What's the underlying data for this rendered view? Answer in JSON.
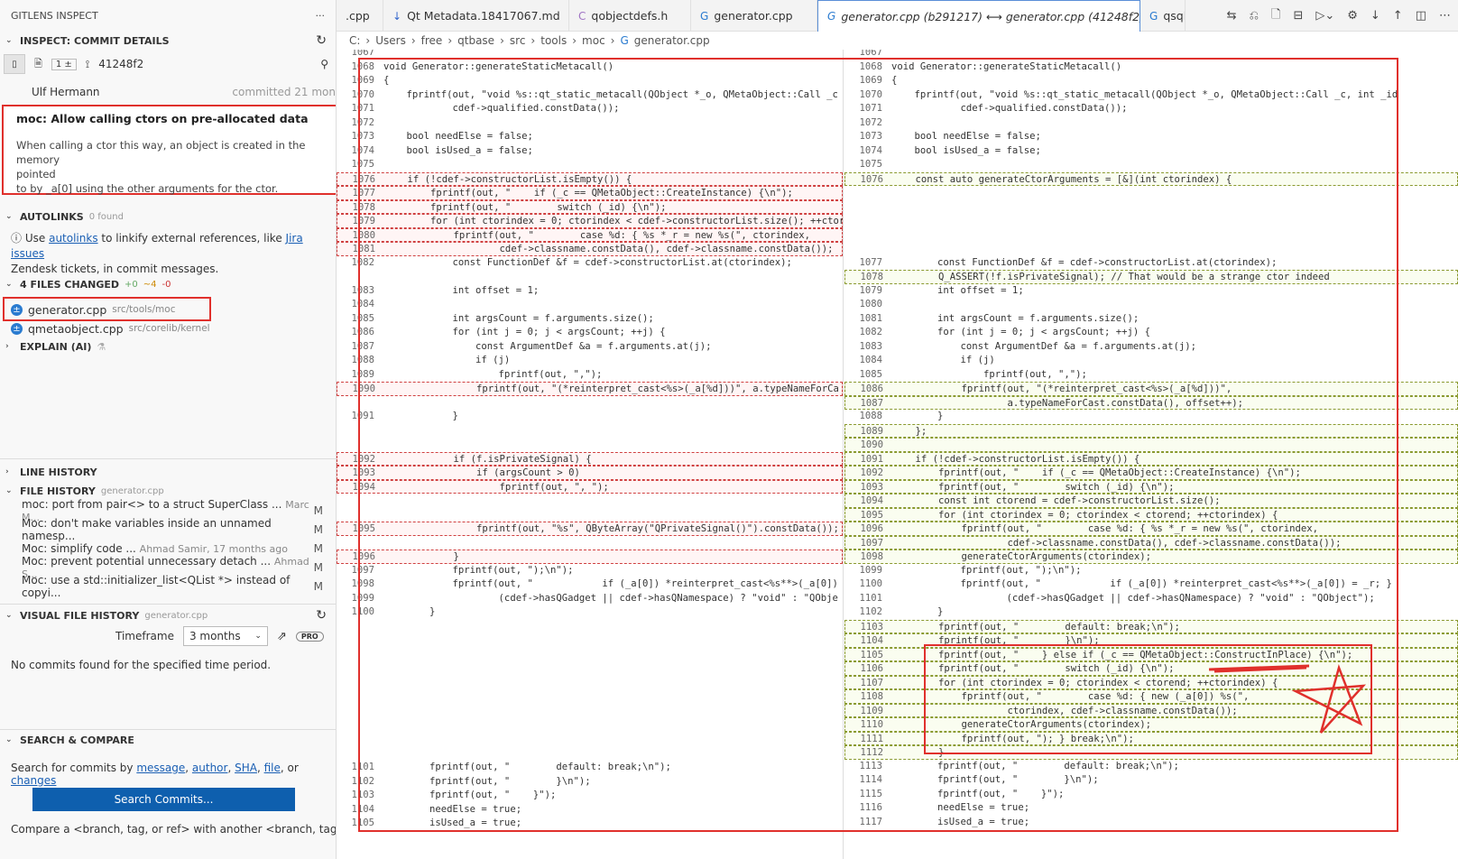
{
  "sidebar": {
    "header": "GITLENS INSPECT",
    "more": "···",
    "inspect": {
      "title": "INSPECT: COMMIT DETAILS",
      "change_count": "1 ±",
      "sha": "41248f2",
      "author": "Ulf Hermann",
      "committed": "committed 21 mon",
      "message_title": "moc: Allow calling ctors on pre-allocated data",
      "message_l1": "When calling a ctor this way, an object is created in the memory",
      "message_l2": "pointed",
      "message_l3": "to by _a[0] using the other arguments for the ctor."
    },
    "autolinks": {
      "title": "AUTOLINKS",
      "count": "0 found",
      "text1": "Use",
      "link1": "autolinks",
      "text2": "to linkify external references, like",
      "link2": "Jira issues",
      "text3": "Zendesk tickets, in commit messages."
    },
    "files": {
      "title": "4 FILES CHANGED",
      "stats_plus": "+0",
      "stats_tilde": "~4",
      "stats_minus": "-0",
      "items": [
        {
          "name": "generator.cpp",
          "path": "src/tools/moc"
        },
        {
          "name": "qmetaobject.cpp",
          "path": "src/corelib/kernel"
        }
      ]
    },
    "explain": {
      "title": "EXPLAIN (AI)"
    },
    "line_history": {
      "title": "LINE HISTORY"
    },
    "file_history": {
      "title": "FILE HISTORY",
      "file": "generator.cpp",
      "items": [
        {
          "msg": "moc: port from pair<> to a struct SuperClass ...",
          "author": "Marc M...",
          "status": "M"
        },
        {
          "msg": "Moc: don't make variables inside an unnamed namesp...",
          "author": "",
          "status": "M"
        },
        {
          "msg": "Moc: simplify code ...",
          "author": "Ahmad Samir, 17 months ago",
          "status": "M"
        },
        {
          "msg": "Moc: prevent potential unnecessary detach ...",
          "author": "Ahmad S...",
          "status": "M"
        },
        {
          "msg": "Moc: use a std::initializer_list<QList *> instead of copyi...",
          "author": "",
          "status": "M"
        }
      ]
    },
    "visual_history": {
      "title": "VISUAL FILE HISTORY",
      "file": "generator.cpp",
      "timeframe_label": "Timeframe",
      "timeframe_value": "3 months",
      "pro": "PRO",
      "empty": "No commits found for the specified time period."
    },
    "search": {
      "title": "SEARCH & COMPARE",
      "text": "Search for commits by",
      "l1": "message",
      "l2": "author",
      "l3": "SHA",
      "l4": "file",
      "or": "or",
      "l5": "changes",
      "button": "Search Commits...",
      "compare": "Compare a <branch, tag, or ref> with another <branch, tag"
    }
  },
  "tabs": [
    {
      "label": ".cpp",
      "icon": ""
    },
    {
      "label": "Qt Metadata.18417067.md",
      "icon": "↓"
    },
    {
      "label": "qobjectdefs.h",
      "icon": "C"
    },
    {
      "label": "generator.cpp",
      "icon": "G"
    },
    {
      "label": "generator.cpp (b291217) ⟷ generator.cpp (41248f2)",
      "icon": "G"
    },
    {
      "label": "qsql",
      "icon": "G"
    }
  ],
  "breadcrumb": [
    "C:",
    "Users",
    "free",
    "qtbase",
    "src",
    "tools",
    "moc",
    "generator.cpp"
  ],
  "left_lines": [
    {
      "n": "1067",
      "t": ""
    },
    {
      "n": "1068",
      "t": "void Generator::generateStaticMetacall()"
    },
    {
      "n": "1069",
      "t": "{"
    },
    {
      "n": "1070",
      "t": "    fprintf(out, \"void %s::qt_static_metacall(QObject *_o, QMetaObject::Call _c"
    },
    {
      "n": "1071",
      "t": "            cdef->qualified.constData());"
    },
    {
      "n": "1072",
      "t": ""
    },
    {
      "n": "1073",
      "t": "    bool needElse = false;"
    },
    {
      "n": "1074",
      "t": "    bool isUsed_a = false;"
    },
    {
      "n": "1075",
      "t": ""
    },
    {
      "n": "1076",
      "t": "    if (!cdef->constructorList.isEmpty()) {",
      "c": "del"
    },
    {
      "n": "1077",
      "t": "        fprintf(out, \"    if (_c == QMetaObject::CreateInstance) {\\n\");",
      "c": "del"
    },
    {
      "n": "1078",
      "t": "        fprintf(out, \"        switch (_id) {\\n\");",
      "c": "del"
    },
    {
      "n": "1079",
      "t": "        for (int ctorindex = 0; ctorindex < cdef->constructorList.size(); ++ctor",
      "c": "del"
    },
    {
      "n": "1080",
      "t": "            fprintf(out, \"        case %d: { %s *_r = new %s(\", ctorindex,",
      "c": "del"
    },
    {
      "n": "1081",
      "t": "                    cdef->classname.constData(), cdef->classname.constData());",
      "c": "del"
    },
    {
      "n": "1082",
      "t": "            const FunctionDef &f = cdef->constructorList.at(ctorindex);"
    },
    {
      "n": "",
      "t": ""
    },
    {
      "n": "1083",
      "t": "            int offset = 1;"
    },
    {
      "n": "1084",
      "t": ""
    },
    {
      "n": "1085",
      "t": "            int argsCount = f.arguments.size();"
    },
    {
      "n": "1086",
      "t": "            for (int j = 0; j < argsCount; ++j) {"
    },
    {
      "n": "1087",
      "t": "                const ArgumentDef &a = f.arguments.at(j);"
    },
    {
      "n": "1088",
      "t": "                if (j)"
    },
    {
      "n": "1089",
      "t": "                    fprintf(out, \",\");"
    },
    {
      "n": "1090",
      "t": "                fprintf(out, \"(*reinterpret_cast<%s>(_a[%d]))\", a.typeNameForCa",
      "c": "del"
    },
    {
      "n": "",
      "t": ""
    },
    {
      "n": "1091",
      "t": "            }"
    },
    {
      "n": "",
      "t": ""
    },
    {
      "n": "",
      "t": ""
    },
    {
      "n": "1092",
      "t": "            if (f.isPrivateSignal) {",
      "c": "del"
    },
    {
      "n": "1093",
      "t": "                if (argsCount > 0)",
      "c": "del"
    },
    {
      "n": "1094",
      "t": "                    fprintf(out, \", \");",
      "c": "del"
    },
    {
      "n": "",
      "t": ""
    },
    {
      "n": "",
      "t": ""
    },
    {
      "n": "1095",
      "t": "                fprintf(out, \"%s\", QByteArray(\"QPrivateSignal()\").constData());",
      "c": "del"
    },
    {
      "n": "",
      "t": ""
    },
    {
      "n": "1096",
      "t": "            }",
      "c": "del"
    },
    {
      "n": "1097",
      "t": "            fprintf(out, \");\\n\");"
    },
    {
      "n": "1098",
      "t": "            fprintf(out, \"            if (_a[0]) *reinterpret_cast<%s**>(_a[0])"
    },
    {
      "n": "1099",
      "t": "                    (cdef->hasQGadget || cdef->hasQNamespace) ? \"void\" : \"QObje"
    },
    {
      "n": "1100",
      "t": "        }"
    }
  ],
  "left_bottom": [
    {
      "n": "1101",
      "t": "        fprintf(out, \"        default: break;\\n\");"
    },
    {
      "n": "1102",
      "t": "        fprintf(out, \"        }\\n\");"
    },
    {
      "n": "1103",
      "t": "        fprintf(out, \"    }\");"
    },
    {
      "n": "1104",
      "t": "        needElse = true;"
    },
    {
      "n": "1105",
      "t": "        isUsed_a = true;"
    }
  ],
  "right_lines": [
    {
      "n": "1067",
      "t": ""
    },
    {
      "n": "1068",
      "t": "void Generator::generateStaticMetacall()"
    },
    {
      "n": "1069",
      "t": "{"
    },
    {
      "n": "1070",
      "t": "    fprintf(out, \"void %s::qt_static_metacall(QObject *_o, QMetaObject::Call _c, int _id"
    },
    {
      "n": "1071",
      "t": "            cdef->qualified.constData());"
    },
    {
      "n": "1072",
      "t": ""
    },
    {
      "n": "1073",
      "t": "    bool needElse = false;"
    },
    {
      "n": "1074",
      "t": "    bool isUsed_a = false;"
    },
    {
      "n": "1075",
      "t": ""
    },
    {
      "n": "1076",
      "t": "    const auto generateCtorArguments = [&](int ctorindex) {",
      "c": "add"
    },
    {
      "n": "",
      "t": ""
    },
    {
      "n": "",
      "t": ""
    },
    {
      "n": "",
      "t": ""
    },
    {
      "n": "",
      "t": ""
    },
    {
      "n": "",
      "t": ""
    },
    {
      "n": "1077",
      "t": "        const FunctionDef &f = cdef->constructorList.at(ctorindex);"
    },
    {
      "n": "1078",
      "t": "        Q_ASSERT(!f.isPrivateSignal); // That would be a strange ctor indeed",
      "c": "add"
    },
    {
      "n": "1079",
      "t": "        int offset = 1;"
    },
    {
      "n": "1080",
      "t": ""
    },
    {
      "n": "1081",
      "t": "        int argsCount = f.arguments.size();"
    },
    {
      "n": "1082",
      "t": "        for (int j = 0; j < argsCount; ++j) {"
    },
    {
      "n": "1083",
      "t": "            const ArgumentDef &a = f.arguments.at(j);"
    },
    {
      "n": "1084",
      "t": "            if (j)"
    },
    {
      "n": "1085",
      "t": "                fprintf(out, \",\");"
    },
    {
      "n": "1086",
      "t": "            fprintf(out, \"(*reinterpret_cast<%s>(_a[%d]))\",",
      "c": "add"
    },
    {
      "n": "1087",
      "t": "                    a.typeNameForCast.constData(), offset++);",
      "c": "add"
    },
    {
      "n": "1088",
      "t": "        }"
    },
    {
      "n": "1089",
      "t": "    };",
      "c": "add"
    },
    {
      "n": "1090",
      "t": "",
      "c": "add"
    },
    {
      "n": "1091",
      "t": "    if (!cdef->constructorList.isEmpty()) {",
      "c": "add"
    },
    {
      "n": "1092",
      "t": "        fprintf(out, \"    if (_c == QMetaObject::CreateInstance) {\\n\");",
      "c": "add"
    },
    {
      "n": "1093",
      "t": "        fprintf(out, \"        switch (_id) {\\n\");",
      "c": "add"
    },
    {
      "n": "1094",
      "t": "        const int ctorend = cdef->constructorList.size();",
      "c": "add"
    },
    {
      "n": "1095",
      "t": "        for (int ctorindex = 0; ctorindex < ctorend; ++ctorindex) {",
      "c": "add"
    },
    {
      "n": "1096",
      "t": "            fprintf(out, \"        case %d: { %s *_r = new %s(\", ctorindex,",
      "c": "add"
    },
    {
      "n": "1097",
      "t": "                    cdef->classname.constData(), cdef->classname.constData());",
      "c": "add"
    },
    {
      "n": "1098",
      "t": "            generateCtorArguments(ctorindex);",
      "c": "add"
    },
    {
      "n": "1099",
      "t": "            fprintf(out, \");\\n\");"
    },
    {
      "n": "1100",
      "t": "            fprintf(out, \"            if (_a[0]) *reinterpret_cast<%s**>(_a[0]) = _r; }"
    },
    {
      "n": "1101",
      "t": "                    (cdef->hasQGadget || cdef->hasQNamespace) ? \"void\" : \"QObject\");"
    },
    {
      "n": "1102",
      "t": "        }"
    },
    {
      "n": "1103",
      "t": "        fprintf(out, \"        default: break;\\n\");",
      "c": "add"
    },
    {
      "n": "1104",
      "t": "        fprintf(out, \"        }\\n\");",
      "c": "add"
    },
    {
      "n": "1105",
      "t": "        fprintf(out, \"    } else if (_c == QMetaObject::ConstructInPlace) {\\n\");",
      "c": "add"
    },
    {
      "n": "1106",
      "t": "        fprintf(out, \"        switch (_id) {\\n\");",
      "c": "add"
    },
    {
      "n": "1107",
      "t": "        for (int ctorindex = 0; ctorindex < ctorend; ++ctorindex) {",
      "c": "add"
    },
    {
      "n": "1108",
      "t": "            fprintf(out, \"        case %d: { new (_a[0]) %s(\",",
      "c": "add"
    },
    {
      "n": "1109",
      "t": "                    ctorindex, cdef->classname.constData());",
      "c": "add"
    },
    {
      "n": "1110",
      "t": "            generateCtorArguments(ctorindex);",
      "c": "add"
    },
    {
      "n": "1111",
      "t": "            fprintf(out, \"); } break;\\n\");",
      "c": "add"
    },
    {
      "n": "1112",
      "t": "        }",
      "c": "add"
    },
    {
      "n": "1113",
      "t": "        fprintf(out, \"        default: break;\\n\");"
    },
    {
      "n": "1114",
      "t": "        fprintf(out, \"        }\\n\");"
    },
    {
      "n": "1115",
      "t": "        fprintf(out, \"    }\");"
    },
    {
      "n": "1116",
      "t": "        needElse = true;"
    },
    {
      "n": "1117",
      "t": "        isUsed_a = true;"
    }
  ]
}
